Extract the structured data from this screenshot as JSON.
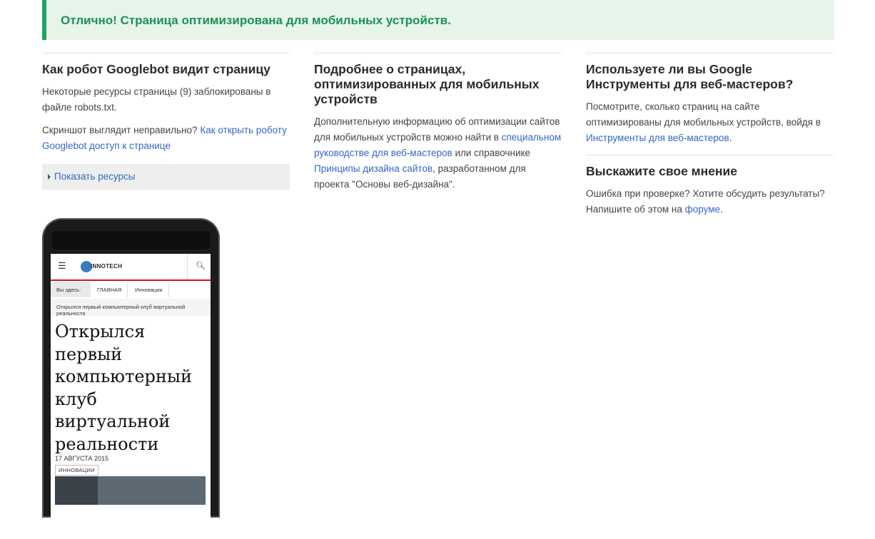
{
  "banner": {
    "text": "Отлично! Страница оптимизирована для мобильных устройств."
  },
  "col1": {
    "heading": "Как робот Googlebot видит страницу",
    "blocked_text": "Некоторые ресурсы страницы (9) заблокированы в файле robots.txt.",
    "screenshot_question": "Скриншот выглядит неправильно?",
    "screenshot_link": "Как открыть роботу Googlebot доступ к странице",
    "show_resources": "Показать ресурсы"
  },
  "col2": {
    "heading": "Подробнее о страницах, оптимизированных для мобильных устройств",
    "text_1": "Дополнительную информацию об оптимизации сайтов для мобильных устройств можно найти в",
    "link_1": "специальном руководстве для веб-мастеров",
    "text_2": "или справочнике",
    "link_2": "Принципы дизайна сайтов",
    "text_3": ", разработанном для проекта \"Основы веб-дизайна\"."
  },
  "col3": {
    "heading_1": "Используете ли вы Google Инструменты для веб-мастеров?",
    "text_1": "Посмотрите, сколько страниц на сайте оптимизированы для мобильных устройств, войдя в",
    "link_1": "Инструменты для веб-мастеров",
    "text_1_end": ".",
    "heading_2": "Выскажите свое мнение",
    "text_2": "Ошибка при проверке? Хотите обсудить результаты? Напишите об этом на",
    "link_2": "форуме",
    "text_2_end": "."
  },
  "mobile": {
    "menu_icon": "hamburger-icon",
    "logo": "INNOTECH",
    "search_icon": "search-icon",
    "breadcrumb_label": "Вы здесь:",
    "breadcrumb_home": "ГЛАВНАЯ",
    "breadcrumb_category": "Инновации",
    "current_page": "Открылся первый компьютерный клуб виртуальной реальности",
    "title": "Открылся первый компьютерный клуб виртуальной реальности",
    "date": "17 АВГУСТА 2015",
    "tag": "ИННОВАЦИИ"
  },
  "colors": {
    "banner_bg": "#e6f4ea",
    "banner_accent": "#1ea362",
    "link": "#3367c3",
    "mobile_accent": "#c9161c"
  }
}
